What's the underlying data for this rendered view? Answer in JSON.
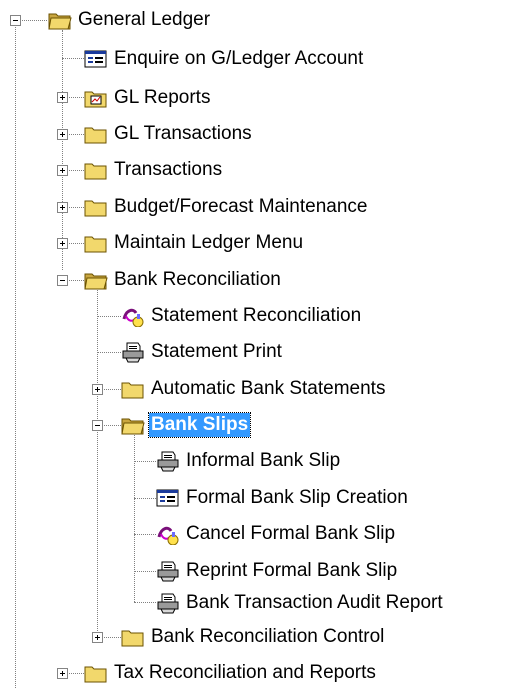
{
  "tree": [
    {
      "label": "General Ledger",
      "icon": "folder-open-icon",
      "expander": "minus"
    },
    {
      "label": "Enquire on G/Ledger Account",
      "icon": "form-icon",
      "expander": null
    },
    {
      "label": "GL Reports",
      "icon": "report-folder-icon",
      "expander": "plus"
    },
    {
      "label": "GL Transactions",
      "icon": "folder-icon",
      "expander": "plus"
    },
    {
      "label": "Transactions",
      "icon": "folder-icon",
      "expander": "plus"
    },
    {
      "label": "Budget/Forecast Maintenance",
      "icon": "folder-icon",
      "expander": "plus"
    },
    {
      "label": "Maintain Ledger Menu",
      "icon": "folder-icon",
      "expander": "plus"
    },
    {
      "label": "Bank Reconciliation",
      "icon": "folder-open-icon",
      "expander": "minus"
    },
    {
      "label": "Statement Reconciliation",
      "icon": "process-icon",
      "expander": null
    },
    {
      "label": "Statement Print",
      "icon": "printer-icon",
      "expander": null
    },
    {
      "label": "Automatic Bank Statements",
      "icon": "folder-icon",
      "expander": "plus"
    },
    {
      "label": "Bank Slips",
      "icon": "folder-open-icon",
      "expander": "minus",
      "selected": true
    },
    {
      "label": "Informal Bank Slip",
      "icon": "printer-icon",
      "expander": null
    },
    {
      "label": "Formal Bank Slip Creation",
      "icon": "form-icon",
      "expander": null
    },
    {
      "label": "Cancel Formal Bank Slip",
      "icon": "process-icon",
      "expander": null
    },
    {
      "label": "Reprint Formal Bank Slip",
      "icon": "printer-icon",
      "expander": null
    },
    {
      "label": "Bank Transaction Audit Report",
      "icon": "printer-icon",
      "expander": null
    },
    {
      "label": "Bank Reconciliation Control",
      "icon": "folder-icon",
      "expander": "plus"
    },
    {
      "label": "Tax Reconciliation and Reports",
      "icon": "folder-icon",
      "expander": "plus"
    }
  ],
  "colors": {
    "selection": "#3399ff",
    "folder": "#f2d86c",
    "tree_lines": "#808080"
  }
}
